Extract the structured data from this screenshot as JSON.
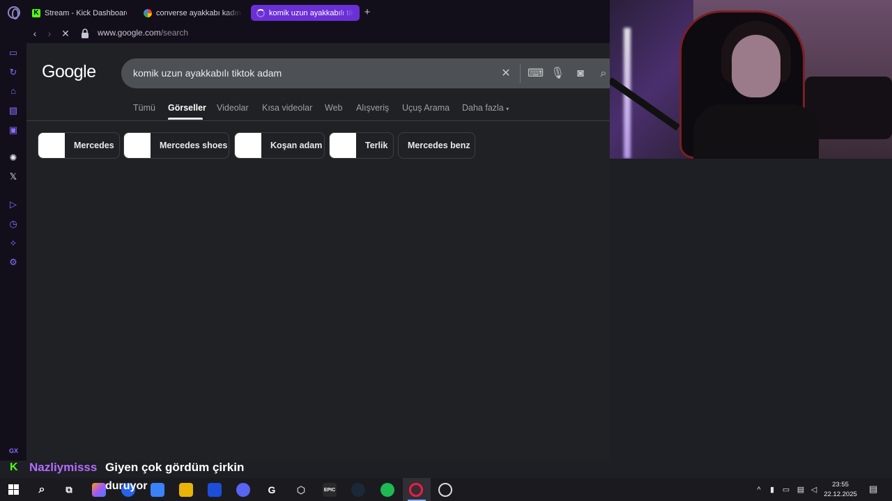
{
  "tabs": [
    {
      "label": "Stream - Kick Dashboard",
      "favicon": "K"
    },
    {
      "label": "converse ayakkabı kadın t"
    },
    {
      "label": "komik uzun ayakkabılı tiktok"
    }
  ],
  "address": {
    "domain": "www.google.com",
    "path": "/search"
  },
  "google": {
    "logo": "Google",
    "query": "komik uzun ayakkabılı tiktok adam",
    "tabs": [
      "Tümü",
      "Görseller",
      "Videolar",
      "Kısa videolar",
      "Web",
      "Alışveriş",
      "Uçuş Arama",
      "Daha fazla"
    ],
    "active_tab": "Görseller",
    "chips": [
      "Mercedes",
      "Mercedes shoes",
      "Koşan adam",
      "Terlik",
      "Mercedes benz"
    ]
  },
  "sidebar": {
    "gx_label": "GX"
  },
  "chat": {
    "brand": "K",
    "user": "Nazliymisss",
    "message": "Giyen çok gördüm çirkin"
  },
  "taskbar": {
    "overlay_text": "duruyor",
    "epic_label": "EPIC",
    "time": "23:55",
    "date": "22.12.2025"
  },
  "colors": {
    "accent": "#6b2fd6",
    "kick_green": "#53fc18",
    "chat_user": "#b46dff"
  }
}
